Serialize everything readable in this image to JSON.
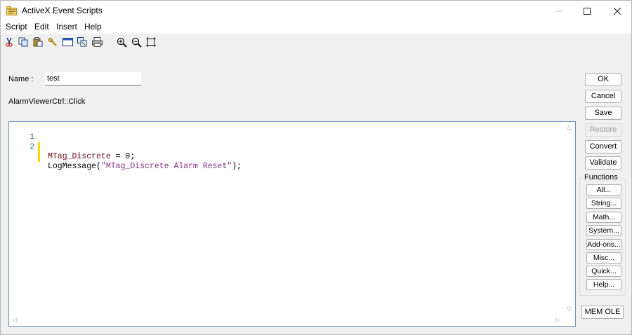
{
  "window": {
    "title": "ActiveX Event Scripts"
  },
  "menu": {
    "items": [
      "Script",
      "Edit",
      "Insert",
      "Help"
    ]
  },
  "toolbar": {
    "icons": [
      "cut-icon",
      "copy-icon",
      "paste-icon",
      "find-icon",
      "window-icon",
      "link-icon",
      "print-icon",
      "zoom-in-icon",
      "zoom-out-icon",
      "fit-icon"
    ]
  },
  "form": {
    "name_label": "Name :",
    "name_value": "test",
    "event_label": "AlarmViewerCtrl::Click"
  },
  "editor": {
    "lines": [
      {
        "num": "1",
        "var": "MTag_Discrete",
        "rest": " = 0;"
      },
      {
        "num": "2",
        "fn": "LogMessage(",
        "str": "\"MTag_Discrete Alarm Reset\"",
        "end": ");"
      }
    ]
  },
  "buttons": {
    "ok": "OK",
    "cancel": "Cancel",
    "save": "Save",
    "restore": "Restore",
    "convert": "Convert",
    "validate": "Validate",
    "mem_ole": "MEM OLE"
  },
  "functions": {
    "title": "Functions",
    "items": [
      "All...",
      "String...",
      "Math...",
      "System...",
      "Add-ons...",
      "Misc...",
      "Quick...",
      "Help..."
    ]
  },
  "colors": {
    "accent_border": "#7090b8",
    "change_bar": "#ffd800",
    "string": "#8b2f8b",
    "variable": "#6a0d1f"
  }
}
